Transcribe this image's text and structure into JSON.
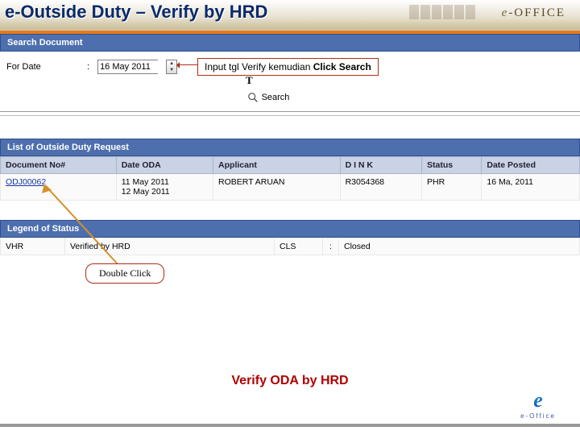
{
  "title": "e-Outside Duty – Verify by HRD",
  "banner": {
    "brand": "e-OFFICE"
  },
  "search_panel": {
    "header": "Search Document",
    "for_date_label": "For Date",
    "for_date_value": "16 May 2011",
    "search_label": "Search",
    "tip_text": "Input tgl Verify kemudian ",
    "tip_bold": "Click Search",
    "t_mark": "T"
  },
  "list": {
    "header": "List of Outside Duty Request",
    "columns": {
      "doc": "Document No#",
      "date": "Date ODA",
      "applicant": "Applicant",
      "nik": "D I N K",
      "status": "Status",
      "posted": "Date Posted"
    },
    "rows": [
      {
        "doc": "ODJ00062",
        "date1": "11 May 2011",
        "date2": "12 May 2011",
        "applicant": "ROBERT ARUAN",
        "nik": "R3054368",
        "status": "PHR",
        "posted": "16 Ma, 2011"
      }
    ]
  },
  "legend": {
    "header": "Legend of Status",
    "code1": "VHR",
    "desc1": "Verified by HRD",
    "code2": "CLS",
    "sep": ":",
    "desc2": "Closed"
  },
  "annotations": {
    "double_click": "Double Click"
  },
  "footer": {
    "title": "Verify ODA by HRD",
    "logo_sub": "e-Office"
  }
}
